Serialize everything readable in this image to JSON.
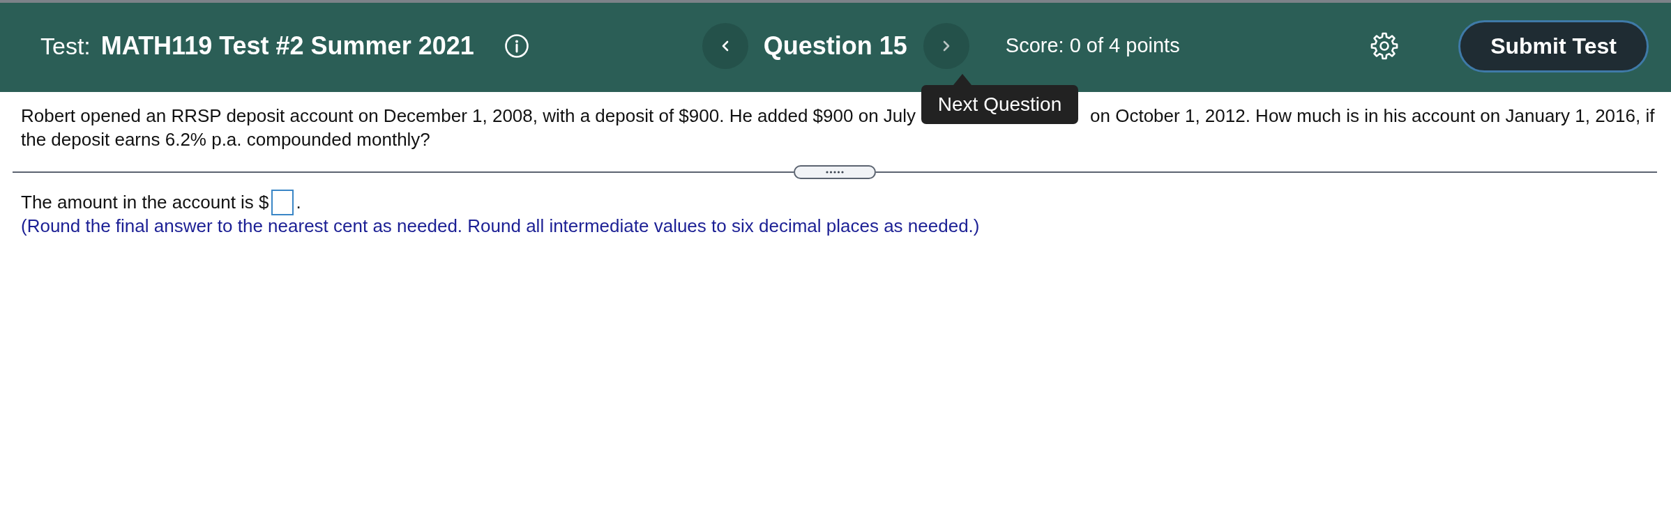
{
  "header": {
    "label": "Test:",
    "title": "MATH119 Test #2 Summer 2021",
    "question_label": "Question 15",
    "next_tooltip": "Next Question",
    "score": "Score: 0 of 4 points",
    "submit_label": "Submit Test"
  },
  "question": {
    "lines": [
      [
        "Robert opened an RRSP deposit account on December 1, 2008, with a deposit of $900. He added $900 on July",
        "on October 1, 2012. How much is in his account on January 1, 2016, if"
      ],
      [
        "the deposit earns 6.2% p.a. compounded monthly?"
      ]
    ]
  },
  "answer": {
    "prefix": "The amount in the account is $",
    "suffix": ".",
    "hint": "(Round the final answer to the nearest cent as needed. Round all intermediate values to six decimal places as needed.)"
  }
}
